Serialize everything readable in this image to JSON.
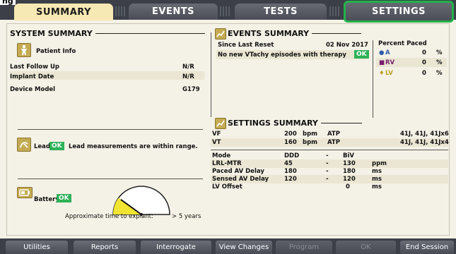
{
  "corner_label": "ng",
  "tabs": [
    {
      "label": "SUMMARY"
    },
    {
      "label": "EVENTS"
    },
    {
      "label": "TESTS"
    },
    {
      "label": "SETTINGS"
    }
  ],
  "system_summary": {
    "title": "SYSTEM SUMMARY",
    "patient_info": "Patient Info",
    "rows": [
      {
        "label": "Last Follow Up",
        "value": "N/R"
      },
      {
        "label": "Implant Date",
        "value": "N/R"
      },
      {
        "label": "Device Model",
        "value": "G179"
      }
    ],
    "leads_label": "Leads",
    "leads_status": "OK",
    "leads_message": "Lead measurements are within range.",
    "battery_label": "Battery",
    "battery_status": "OK",
    "battery_level": 0.2,
    "explant_label": "Approximate time to explant:",
    "explant_value": "> 5 years"
  },
  "events_summary": {
    "title": "EVENTS SUMMARY",
    "since_label": "Since Last Reset",
    "since_date": "02 Nov 2017",
    "message": "No new VTachy episodes with therapy",
    "status": "OK",
    "percent_paced_title": "Percent Paced",
    "paced": [
      {
        "label": "A",
        "value": "0",
        "unit": "%",
        "color": "#2d5aa8"
      },
      {
        "label": "RV",
        "value": "0",
        "unit": "%",
        "color": "#7a1d6e"
      },
      {
        "label": "LV",
        "value": "0",
        "unit": "%",
        "color": "#b8a21e"
      }
    ]
  },
  "settings_summary": {
    "title": "SETTINGS SUMMARY",
    "zones": [
      {
        "name": "VF",
        "rate": "200",
        "unit": "bpm",
        "therapy": "ATP",
        "shocks": "41J, 41J, 41Jx6"
      },
      {
        "name": "VT",
        "rate": "160",
        "unit": "bpm",
        "therapy": "ATP",
        "shocks": "41J, 41J, 41Jx4"
      }
    ],
    "params": [
      {
        "label": "Mode",
        "v1": "DDD",
        "sep": "-",
        "v2": "BiV",
        "unit": ""
      },
      {
        "label": "LRL-MTR",
        "v1": "45",
        "sep": "-",
        "v2": "130",
        "unit": "ppm"
      },
      {
        "label": "Paced AV Delay",
        "v1": "180",
        "sep": "-",
        "v2": "180",
        "unit": "ms"
      },
      {
        "label": "Sensed AV Delay",
        "v1": "120",
        "sep": "-",
        "v2": "120",
        "unit": "ms"
      },
      {
        "label": "LV Offset",
        "v1": "",
        "sep": "",
        "v2": "0",
        "unit": "ms"
      }
    ]
  },
  "bottom_buttons": [
    {
      "label": "Utilities"
    },
    {
      "label": "Reports"
    },
    {
      "label": "Interrogate"
    },
    {
      "label": "View Changes"
    },
    {
      "label": "Program"
    },
    {
      "label": "OK"
    },
    {
      "label": "End Session"
    }
  ],
  "colors": {
    "ok_green": "#2fb158",
    "settings_highlight": "#22b24a",
    "active_tab": "#f7e9b3",
    "icon_gold": "#c4ab52"
  }
}
